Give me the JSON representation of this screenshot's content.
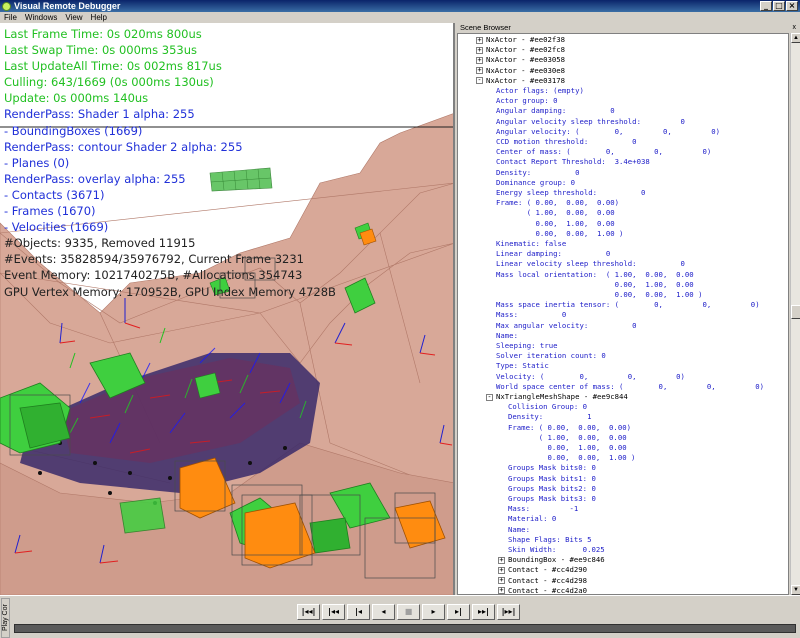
{
  "window": {
    "title": "Visual Remote Debugger",
    "controls": {
      "minimize": "_",
      "maximize": "□",
      "close": "×"
    }
  },
  "menu": [
    "File",
    "Windows",
    "View",
    "Help"
  ],
  "viewport": {
    "stats": [
      {
        "text": "Last Frame Time: 0s 020ms 800us",
        "color": "green"
      },
      {
        "text": "Last Swap Time: 0s 000ms 353us",
        "color": "green"
      },
      {
        "text": "Last UpdateAll Time: 0s 002ms 817us",
        "color": "green"
      },
      {
        "text": "Culling: 643/1669 (0s 000ms 130us)",
        "color": "green"
      },
      {
        "text": "Update: 0s 000ms 140us",
        "color": "green"
      },
      {
        "text": "RenderPass: Shader 1  alpha: 255",
        "color": "blue"
      },
      {
        "text": "- BoundingBoxes (1669)",
        "color": "blue"
      },
      {
        "text": "RenderPass: contour Shader 2  alpha: 255",
        "color": "blue"
      },
      {
        "text": "- Planes (0)",
        "color": "blue"
      },
      {
        "text": "RenderPass: overlay  alpha: 255",
        "color": "blue"
      },
      {
        "text": "- Contacts (3671)",
        "color": "blue"
      },
      {
        "text": "- Frames (1670)",
        "color": "blue"
      },
      {
        "text": "- Velocities (1669)",
        "color": "blue"
      },
      {
        "text": "#Objects: 9335, Removed 11915",
        "color": "dark"
      },
      {
        "text": "#Events: 35828594/35976792, Current Frame 3231",
        "color": "dark"
      },
      {
        "text": "Event Memory: 1021740275B, #Allocations 354743",
        "color": "dark"
      },
      {
        "text": "GPU Vertex Memory: 170952B, GPU Index Memory 4728B",
        "color": "dark"
      }
    ],
    "colors": {
      "green": "#22c022",
      "blue": "#2030d8",
      "dark": "#222222",
      "terrain": "#d9a898",
      "terrain_edge": "#b88070"
    }
  },
  "scene_browser": {
    "title": "Scene Browser",
    "close": "x",
    "rows": [
      {
        "indent": 2,
        "node": "+",
        "text": "NxActor - #ee02f38"
      },
      {
        "indent": 2,
        "node": "+",
        "text": "NxActor - #ee02fc8"
      },
      {
        "indent": 2,
        "node": "+",
        "text": "NxActor - #ee03058"
      },
      {
        "indent": 2,
        "node": "+",
        "text": "NxActor - #ee030e8"
      },
      {
        "indent": 2,
        "node": "-",
        "text": "NxActor - #ee03178"
      },
      {
        "indent": 3,
        "text": "Actor flags: (empty)"
      },
      {
        "indent": 3,
        "text": "Actor group: 0"
      },
      {
        "indent": 3,
        "text": "Angular damping:          0"
      },
      {
        "indent": 3,
        "text": "Angular velocity sleep threshold:         0"
      },
      {
        "indent": 3,
        "text": "Angular velocity: (        0,         0,         0)"
      },
      {
        "indent": 3,
        "text": "CCD motion threshold:          0"
      },
      {
        "indent": 3,
        "text": "Center of mass: (        0,         0,         0)"
      },
      {
        "indent": 3,
        "text": "Contact Report Threshold:  3.4e+038"
      },
      {
        "indent": 3,
        "text": "Density:          0"
      },
      {
        "indent": 3,
        "text": "Dominance group: 0"
      },
      {
        "indent": 3,
        "text": "Energy sleep threshold:          0"
      },
      {
        "indent": 3,
        "text": "Frame: ( 0.00,  0.00,  0.00)"
      },
      {
        "indent": 3,
        "text": "       ( 1.00,  0.00,  0.00"
      },
      {
        "indent": 3,
        "text": "         0.00,  1.00,  0.00"
      },
      {
        "indent": 3,
        "text": "         0.00,  0.00,  1.00 )"
      },
      {
        "indent": 3,
        "text": "Kinematic: false"
      },
      {
        "indent": 3,
        "text": "Linear damping:          0"
      },
      {
        "indent": 3,
        "text": "Linear velocity sleep threshold:          0"
      },
      {
        "indent": 3,
        "text": "Mass local orientation:  ( 1.00,  0.00,  0.00"
      },
      {
        "indent": 3,
        "text": "                           0.00,  1.00,  0.00"
      },
      {
        "indent": 3,
        "text": "                           0.00,  0.00,  1.00 )"
      },
      {
        "indent": 3,
        "text": "Mass space inertia tensor: (        0,         0,         0)"
      },
      {
        "indent": 3,
        "text": "Mass:          0"
      },
      {
        "indent": 3,
        "text": "Max angular velocity:          0"
      },
      {
        "indent": 3,
        "text": "Name:"
      },
      {
        "indent": 3,
        "text": "Sleeping: true"
      },
      {
        "indent": 3,
        "text": "Solver iteration count: 0"
      },
      {
        "indent": 3,
        "text": "Type: Static"
      },
      {
        "indent": 3,
        "text": "Velocity: (        0,         0,         0)"
      },
      {
        "indent": 3,
        "text": "World space center of mass: (        0,         0,         0)"
      },
      {
        "indent": 3,
        "node": "-",
        "text": "NxTriangleMeshShape - #ee9c844"
      },
      {
        "indent": 4,
        "text": "Collision Group: 0"
      },
      {
        "indent": 4,
        "text": "Density:          1"
      },
      {
        "indent": 4,
        "text": "Frame: ( 0.00,  0.00,  0.00)"
      },
      {
        "indent": 4,
        "text": "       ( 1.00,  0.00,  0.00"
      },
      {
        "indent": 4,
        "text": "         0.00,  1.00,  0.00"
      },
      {
        "indent": 4,
        "text": "         0.00,  0.00,  1.00 )"
      },
      {
        "indent": 4,
        "text": "Groups Mask bits0: 0"
      },
      {
        "indent": 4,
        "text": "Groups Mask bits1: 0"
      },
      {
        "indent": 4,
        "text": "Groups Mask bits2: 0"
      },
      {
        "indent": 4,
        "text": "Groups Mask bits3: 0"
      },
      {
        "indent": 4,
        "text": "Mass:         -1"
      },
      {
        "indent": 4,
        "text": "Material: 0"
      },
      {
        "indent": 4,
        "text": "Name:"
      },
      {
        "indent": 4,
        "text": "Shape Flags: Bits 5"
      },
      {
        "indent": 4,
        "text": "Skin Width:      0.025"
      },
      {
        "indent": 4,
        "node": "+",
        "text": "BoundingBox - #ee9c846"
      },
      {
        "indent": 4,
        "node": "+",
        "text": "Contact - #cc4d290"
      },
      {
        "indent": 4,
        "node": "+",
        "text": "Contact - #cc4d298"
      },
      {
        "indent": 4,
        "node": "+",
        "text": "Contact - #cc4d2a0"
      },
      {
        "indent": 4,
        "node": "+",
        "text": "Contact - #cc4d2a8"
      }
    ]
  },
  "playback": {
    "side_tab": "Play Cor",
    "buttons": [
      {
        "label": "|◂◂|",
        "name": "first-frame-button",
        "disabled": false
      },
      {
        "label": "|◂◂",
        "name": "rewind-button",
        "disabled": false
      },
      {
        "label": "|◂",
        "name": "step-back-button",
        "disabled": false
      },
      {
        "label": "◂",
        "name": "play-backward-button",
        "disabled": false
      },
      {
        "label": "■",
        "name": "stop-button",
        "disabled": true
      },
      {
        "label": "▸",
        "name": "play-button",
        "disabled": false
      },
      {
        "label": "▸|",
        "name": "step-forward-button",
        "disabled": false
      },
      {
        "label": "▸▸|",
        "name": "fast-forward-button",
        "disabled": false
      },
      {
        "label": "|▸▸|",
        "name": "last-frame-button",
        "disabled": false
      }
    ]
  }
}
